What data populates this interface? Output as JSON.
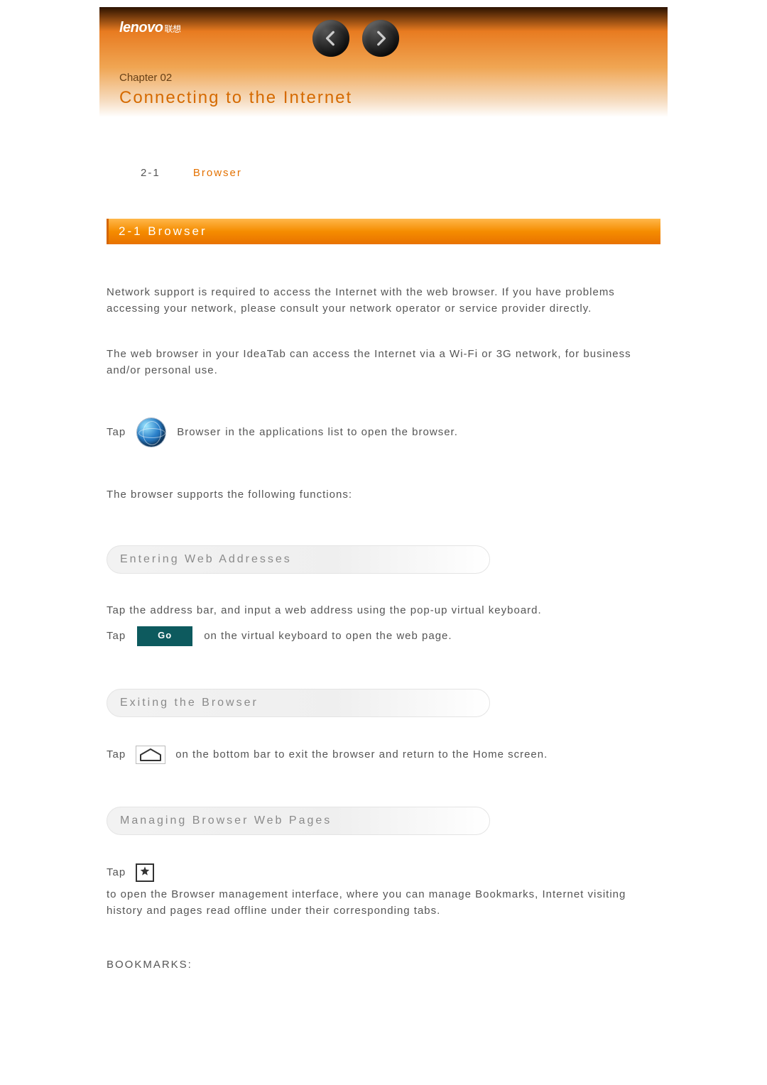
{
  "logo": {
    "brand": "lenovo",
    "cn": "联想"
  },
  "hero": {
    "chapter_label": "Chapter 02",
    "chapter_title": "Connecting to the Internet"
  },
  "toc": {
    "items": [
      {
        "num": "2-1",
        "label": "Browser"
      }
    ]
  },
  "section": {
    "title": "2-1 Browser"
  },
  "body": {
    "p1": "Network support is required to access the Internet with the web browser. If you have problems accessing your network, please consult your network operator or service provider directly.",
    "p2": "The web browser in your IdeaTab can access the Internet via a Wi-Fi or 3G network, for business and/or personal use.",
    "p3_pre": "Tap",
    "p3_mid": "Browser",
    "p3_post": "in the applications list to open the browser.",
    "p4": "The browser supports the following functions:",
    "sub1": "Entering Web Addresses",
    "p5": "Tap the address bar, and input a web address using the pop-up virtual keyboard.",
    "p6_pre": "Tap",
    "go_label": "Go",
    "p6_post": "on the virtual keyboard to open the web page.",
    "sub2": "Exiting the Browser",
    "p7_pre": "Tap",
    "p7_post": "on the bottom bar to exit the browser and return to the Home screen.",
    "sub3": "Managing Browser Web Pages",
    "p8_pre": "Tap",
    "p8_post": "to open the Browser management interface, where you can manage Bookmarks, Internet visiting history and pages read offline under their corresponding tabs.",
    "bookmarks_h": "BOOKMARKS:"
  }
}
